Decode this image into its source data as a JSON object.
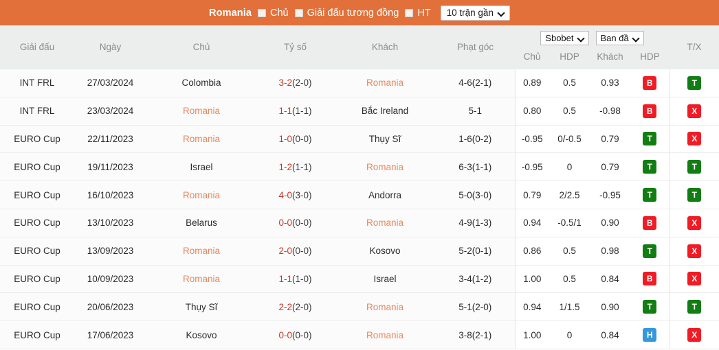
{
  "topbar": {
    "team": "Romania",
    "checkbox_home_label": "Chủ",
    "checkbox_similar_label": "Giải đấu tương đồng",
    "checkbox_ht_label": "HT",
    "matches_select_value": "10 trận gần",
    "accent_color": "#e2703a"
  },
  "table": {
    "headers": {
      "league": "Giải đấu",
      "date": "Ngày",
      "home": "Chủ",
      "score": "Tỷ số",
      "away": "Khách",
      "corners": "Phạt góc",
      "tx": "T/X"
    },
    "odds": {
      "bookmaker_select": "Sbobet",
      "line_select": "Ban đầ",
      "sub_home": "Chủ",
      "sub_hdp1": "HDP",
      "sub_away": "Khách",
      "sub_hdp2": "HDP"
    },
    "rows": [
      {
        "league": "INT FRL",
        "date": "27/03/2024",
        "home": "Colombia",
        "home_highlight": false,
        "score_main": "3-2",
        "score_sub": "(2-0)",
        "away": "Romania",
        "away_highlight": true,
        "corners": "4-6(2-1)",
        "o_home": "0.89",
        "o_hdp1": "0.5",
        "o_away": "0.93",
        "o_hdp2": "B",
        "o_hdp2_type": "B",
        "tx": "T",
        "tx_type": "T"
      },
      {
        "league": "INT FRL",
        "date": "23/03/2024",
        "home": "Romania",
        "home_highlight": true,
        "score_main": "1-1",
        "score_sub": "(1-1)",
        "away": "Bắc Ireland",
        "away_highlight": false,
        "corners": "5-1",
        "o_home": "0.80",
        "o_hdp1": "0.5",
        "o_away": "-0.98",
        "o_hdp2": "B",
        "o_hdp2_type": "B",
        "tx": "X",
        "tx_type": "X"
      },
      {
        "league": "EURO Cup",
        "date": "22/11/2023",
        "home": "Romania",
        "home_highlight": true,
        "score_main": "1-0",
        "score_sub": "(0-0)",
        "away": "Thụy Sĩ",
        "away_highlight": false,
        "corners": "1-6(0-2)",
        "o_home": "-0.95",
        "o_hdp1": "0/-0.5",
        "o_away": "0.79",
        "o_hdp2": "T",
        "o_hdp2_type": "T",
        "tx": "X",
        "tx_type": "X"
      },
      {
        "league": "EURO Cup",
        "date": "19/11/2023",
        "home": "Israel",
        "home_highlight": false,
        "score_main": "1-2",
        "score_sub": "(1-1)",
        "away": "Romania",
        "away_highlight": true,
        "corners": "6-3(1-1)",
        "o_home": "-0.95",
        "o_hdp1": "0",
        "o_away": "0.79",
        "o_hdp2": "T",
        "o_hdp2_type": "T",
        "tx": "T",
        "tx_type": "T"
      },
      {
        "league": "EURO Cup",
        "date": "16/10/2023",
        "home": "Romania",
        "home_highlight": true,
        "score_main": "4-0",
        "score_sub": "(3-0)",
        "away": "Andorra",
        "away_highlight": false,
        "corners": "5-0(3-0)",
        "o_home": "0.79",
        "o_hdp1": "2/2.5",
        "o_away": "-0.95",
        "o_hdp2": "T",
        "o_hdp2_type": "T",
        "tx": "T",
        "tx_type": "T"
      },
      {
        "league": "EURO Cup",
        "date": "13/10/2023",
        "home": "Belarus",
        "home_highlight": false,
        "score_main": "0-0",
        "score_sub": "(0-0)",
        "away": "Romania",
        "away_highlight": true,
        "corners": "4-9(1-3)",
        "o_home": "0.94",
        "o_hdp1": "-0.5/1",
        "o_away": "0.90",
        "o_hdp2": "B",
        "o_hdp2_type": "B",
        "tx": "X",
        "tx_type": "X"
      },
      {
        "league": "EURO Cup",
        "date": "13/09/2023",
        "home": "Romania",
        "home_highlight": true,
        "score_main": "2-0",
        "score_sub": "(0-0)",
        "away": "Kosovo",
        "away_highlight": false,
        "corners": "5-2(0-1)",
        "o_home": "0.86",
        "o_hdp1": "0.5",
        "o_away": "0.98",
        "o_hdp2": "T",
        "o_hdp2_type": "T",
        "tx": "X",
        "tx_type": "X"
      },
      {
        "league": "EURO Cup",
        "date": "10/09/2023",
        "home": "Romania",
        "home_highlight": true,
        "score_main": "1-1",
        "score_sub": "(1-0)",
        "away": "Israel",
        "away_highlight": false,
        "corners": "3-4(1-2)",
        "o_home": "1.00",
        "o_hdp1": "0.5",
        "o_away": "0.84",
        "o_hdp2": "B",
        "o_hdp2_type": "B",
        "tx": "X",
        "tx_type": "X"
      },
      {
        "league": "EURO Cup",
        "date": "20/06/2023",
        "home": "Thụy Sĩ",
        "home_highlight": false,
        "score_main": "2-2",
        "score_sub": "(2-0)",
        "away": "Romania",
        "away_highlight": true,
        "corners": "5-1(2-0)",
        "o_home": "0.94",
        "o_hdp1": "1/1.5",
        "o_away": "0.90",
        "o_hdp2": "T",
        "o_hdp2_type": "T",
        "tx": "T",
        "tx_type": "T"
      },
      {
        "league": "EURO Cup",
        "date": "17/06/2023",
        "home": "Kosovo",
        "home_highlight": false,
        "score_main": "0-0",
        "score_sub": "(0-0)",
        "away": "Romania",
        "away_highlight": true,
        "corners": "3-8(2-1)",
        "o_home": "1.00",
        "o_hdp1": "0",
        "o_away": "0.84",
        "o_hdp2": "H",
        "o_hdp2_type": "H",
        "tx": "X",
        "tx_type": "X"
      }
    ]
  },
  "colors": {
    "badge_red": "#ef1c25",
    "badge_green": "#127d13",
    "badge_blue": "#3498db",
    "highlight_team": "#e8875c",
    "score_red": "#c0392b"
  }
}
